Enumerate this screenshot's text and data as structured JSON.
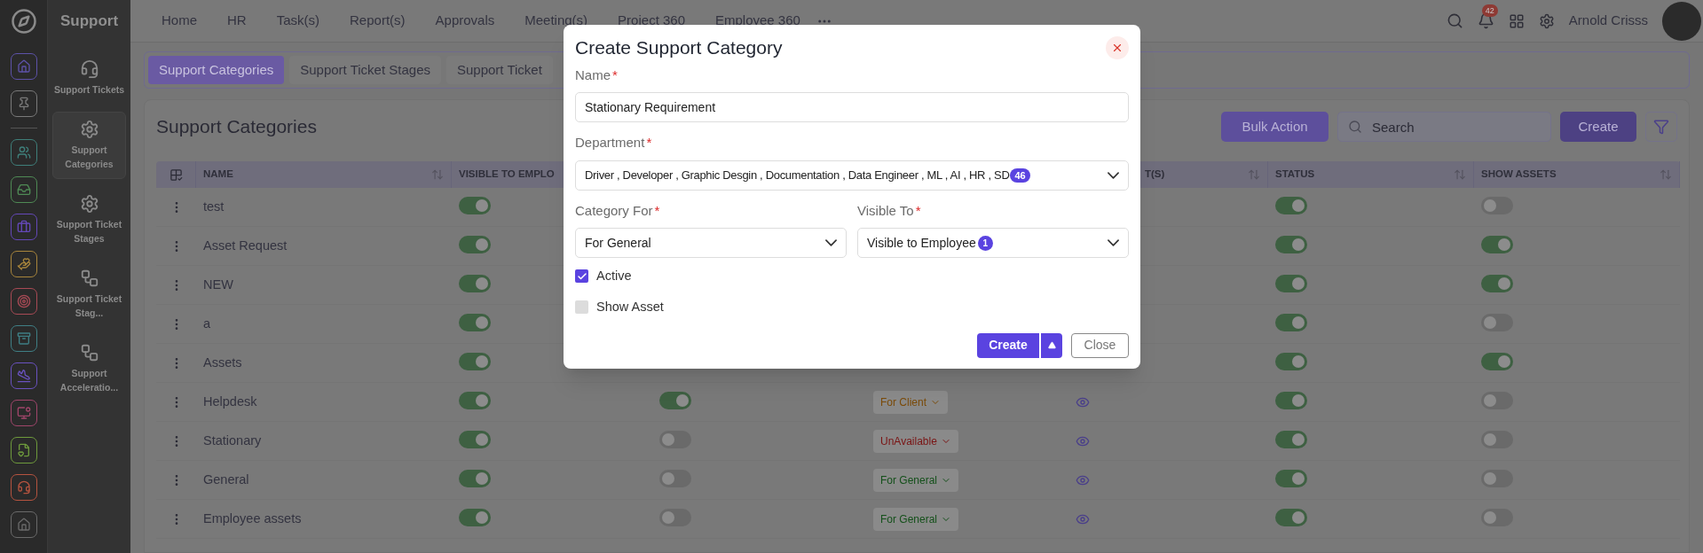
{
  "rail": {
    "items": [
      {
        "kind": "house",
        "color": "#5d52a8"
      },
      {
        "kind": "pin",
        "color": "#7a7a7a"
      },
      {
        "kind": "users",
        "color": "#3f7f7a"
      },
      {
        "kind": "inbox",
        "color": "#4f8a55"
      },
      {
        "kind": "briefcase",
        "color": "#6448b8"
      },
      {
        "kind": "hand",
        "color": "#a8853c"
      },
      {
        "kind": "target",
        "color": "#a84a55"
      },
      {
        "kind": "archive",
        "color": "#3f7f85"
      },
      {
        "kind": "plane",
        "color": "#6a52c0"
      },
      {
        "kind": "monitor",
        "color": "#a0456a"
      },
      {
        "kind": "file",
        "color": "#6e9a3c"
      },
      {
        "kind": "headset",
        "color": "#b5533f"
      },
      {
        "kind": "house",
        "color": "#6a6a6a"
      }
    ]
  },
  "app_title": "Support",
  "sidebar": {
    "items": [
      {
        "label": "Support Tickets",
        "kind": "headset",
        "selected": false
      },
      {
        "label": "Support Categories",
        "kind": "gear",
        "selected": true
      },
      {
        "label": "Support Ticket Stages",
        "kind": "gear",
        "selected": false
      },
      {
        "label": "Support Ticket Stag...",
        "kind": "flow",
        "selected": false
      },
      {
        "label": "Support Acceleratio...",
        "kind": "flow",
        "selected": false
      }
    ]
  },
  "nav": {
    "items": [
      "Home",
      "HR",
      "Task(s)",
      "Report(s)",
      "Approvals",
      "Meeting(s)",
      "Project 360",
      "Employee 360"
    ]
  },
  "header": {
    "notifications": "42",
    "user": "Arnold Crisss"
  },
  "tabs": [
    {
      "label": "Support Categories",
      "selected": true
    },
    {
      "label": "Support Ticket Stages",
      "selected": false
    },
    {
      "label": "Support Ticket",
      "selected": false
    }
  ],
  "page": {
    "title": "Support Categories",
    "bulk_action": "Bulk Action",
    "search": {
      "placeholder": "Search"
    },
    "create": "Create"
  },
  "table": {
    "columns": {
      "name": "NAME",
      "column_2": "VISIBLE TO EMPLO",
      "column_5": "T(S)",
      "status": "STATUS",
      "show_assets": "SHOW ASSETS"
    },
    "rows": [
      {
        "name": "test",
        "column_2": true,
        "status": true,
        "show_assets": false
      },
      {
        "name": "Asset Request",
        "column_2": true,
        "status": true,
        "show_assets": true
      },
      {
        "name": "NEW",
        "column_2": true,
        "status": true,
        "show_assets": true
      },
      {
        "name": "a",
        "column_2": true,
        "status": true,
        "show_assets": false
      },
      {
        "name": "Assets",
        "column_2": true,
        "status": true,
        "show_assets": true
      },
      {
        "name": "Helpdesk",
        "column_2": true,
        "column_3": true,
        "category": {
          "label": "For Client",
          "color": "#7a4a08"
        },
        "view": true,
        "status": true,
        "show_assets": false
      },
      {
        "name": "Stationary",
        "column_2": true,
        "column_3": false,
        "category": {
          "label": "UnAvailable",
          "color": "#7a1414"
        },
        "view": true,
        "status": true,
        "show_assets": false
      },
      {
        "name": "General",
        "column_2": true,
        "column_3": false,
        "category": {
          "label": "For General",
          "color": "#14501a"
        },
        "view": true,
        "status": true,
        "show_assets": false
      },
      {
        "name": "Employee assets",
        "column_2": true,
        "column_3": false,
        "category": {
          "label": "For General",
          "color": "#14501a"
        },
        "view": true,
        "status": true,
        "show_assets": false
      }
    ]
  },
  "modal": {
    "title": "Create Support Category",
    "name": {
      "label": "Name",
      "required": "*",
      "value": "Stationary Requirement"
    },
    "department": {
      "label": "Department",
      "required": "*",
      "value": "Driver , Developer , Graphic Desgin , Documentation , Data Engineer , ML , AI , HR , SD",
      "count": "46"
    },
    "category_for": {
      "label": "Category For",
      "required": "*",
      "value": "For General"
    },
    "visible_to": {
      "label": "Visible To",
      "required": "*",
      "value": "Visible to Employee",
      "count": "1"
    },
    "checkboxes": [
      {
        "label": "Active",
        "checked": true
      },
      {
        "label": "Show Asset",
        "checked": false
      }
    ],
    "create": "Create",
    "close": "Close"
  }
}
